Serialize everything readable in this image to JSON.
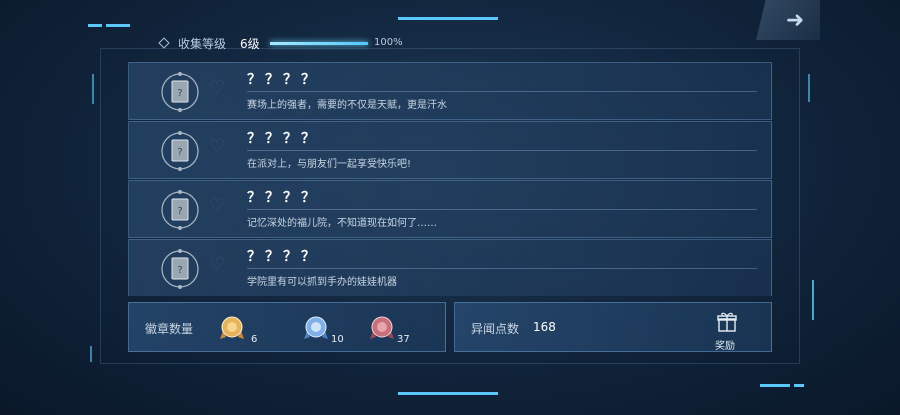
{
  "header": {
    "label": "收集等级",
    "level": "6级",
    "progress_text": "100%",
    "progress": 1.0
  },
  "exit_button": {
    "icon": "arrow-exit-icon"
  },
  "entries": [
    {
      "title": "？？？？",
      "desc": "赛场上的强者，需要的不仅是天赋，更是汗水",
      "icon": "locked-badge-icon"
    },
    {
      "title": "？？？？",
      "desc": "在派对上，与朋友们一起享受快乐吧!",
      "icon": "locked-badge-icon"
    },
    {
      "title": "？？？？",
      "desc": "记忆深处的福儿院，不知道现在如何了……",
      "icon": "locked-badge-icon"
    },
    {
      "title": "？？？？",
      "desc": "学院里有可以抓到手办的娃娃机器",
      "icon": "locked-badge-icon"
    }
  ],
  "badges_panel": {
    "label": "徽章数量",
    "medals": [
      {
        "color": "#d9a24a",
        "count": "6",
        "icon": "gold-medal-icon"
      },
      {
        "color": "#6f9fe0",
        "count": "10",
        "icon": "silver-medal-icon"
      },
      {
        "color": "#c0606a",
        "count": "37",
        "icon": "bronze-medal-icon"
      }
    ]
  },
  "points_panel": {
    "label": "异闻点数",
    "value": "168",
    "reward_label": "奖励",
    "reward_icon": "gift-icon"
  }
}
